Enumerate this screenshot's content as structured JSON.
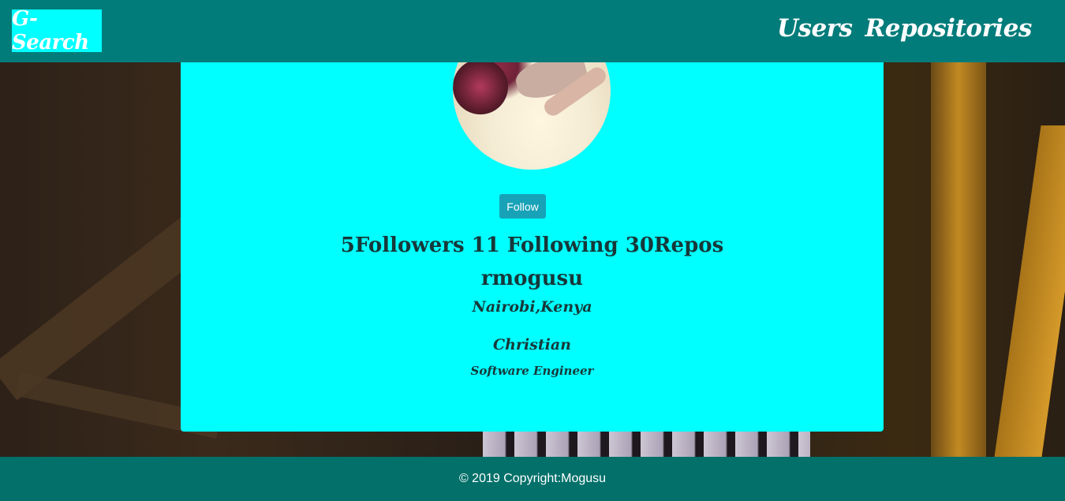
{
  "navbar": {
    "brand": "G-Search",
    "links": [
      {
        "label": "Users"
      },
      {
        "label": "Repositories"
      }
    ]
  },
  "profile": {
    "follow_label": "Follow",
    "stats": "5Followers 11 Following 30Repos",
    "username": "rmogusu",
    "location": "Nairobi,Kenya",
    "name": "Christian",
    "bio": "Software Engineer"
  },
  "footer": {
    "copyright": "© 2019 Copyright:Mogusu"
  },
  "colors": {
    "navbar": "#027c7a",
    "card": "#00ffff",
    "button": "#17a2b8",
    "footer": "#03706a"
  }
}
